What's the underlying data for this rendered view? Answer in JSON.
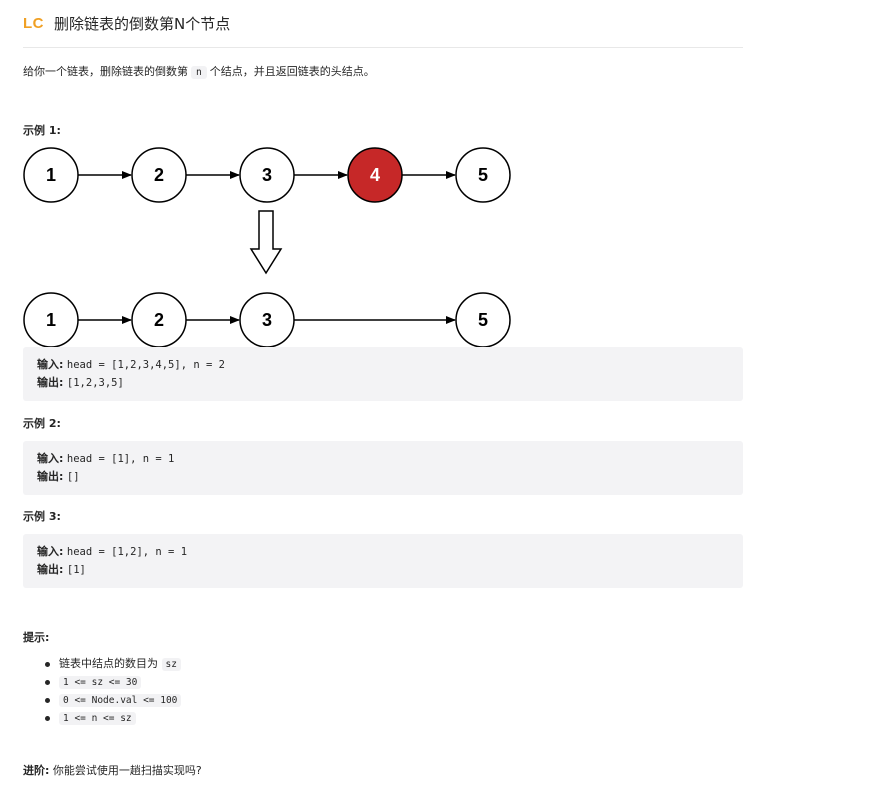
{
  "header": {
    "logo": "LC",
    "title": "删除链表的倒数第N个节点"
  },
  "description": {
    "before": "给你一个链表，删除链表的倒数第",
    "code": "n",
    "after": "个结点，并且返回链表的头结点。"
  },
  "examples": [
    {
      "heading": "示例 1:",
      "input_label": "输入:",
      "input_value": "head = [1,2,3,4,5], n = 2",
      "output_label": "输出:",
      "output_value": "[1,2,3,5]"
    },
    {
      "heading": "示例 2:",
      "input_label": "输入:",
      "input_value": "head = [1], n = 1",
      "output_label": "输出:",
      "output_value": "[]"
    },
    {
      "heading": "示例 3:",
      "input_label": "输入:",
      "input_value": "head = [1,2], n = 1",
      "output_label": "输出:",
      "output_value": "[1]"
    }
  ],
  "diagram": {
    "top_nodes": [
      "1",
      "2",
      "3",
      "4",
      "5"
    ],
    "bottom_nodes": [
      "1",
      "2",
      "3",
      "5"
    ],
    "removed_index": 3,
    "removed_color": "#c62828",
    "node_stroke": "#000000"
  },
  "hints": {
    "heading": "提示:",
    "items": [
      {
        "text": "链表中结点的数目为",
        "code": "sz"
      },
      {
        "text": "",
        "code": "1 <= sz <= 30"
      },
      {
        "text": "",
        "code": "0 <= Node.val <= 100"
      },
      {
        "text": "",
        "code": "1 <= n <= sz"
      }
    ]
  },
  "followup": {
    "label": "进阶:",
    "text": "你能尝试使用一趟扫描实现吗?"
  },
  "colors": {
    "accent": "#f0a024",
    "code_bg": "#f3f3f5",
    "text": "#262626"
  }
}
